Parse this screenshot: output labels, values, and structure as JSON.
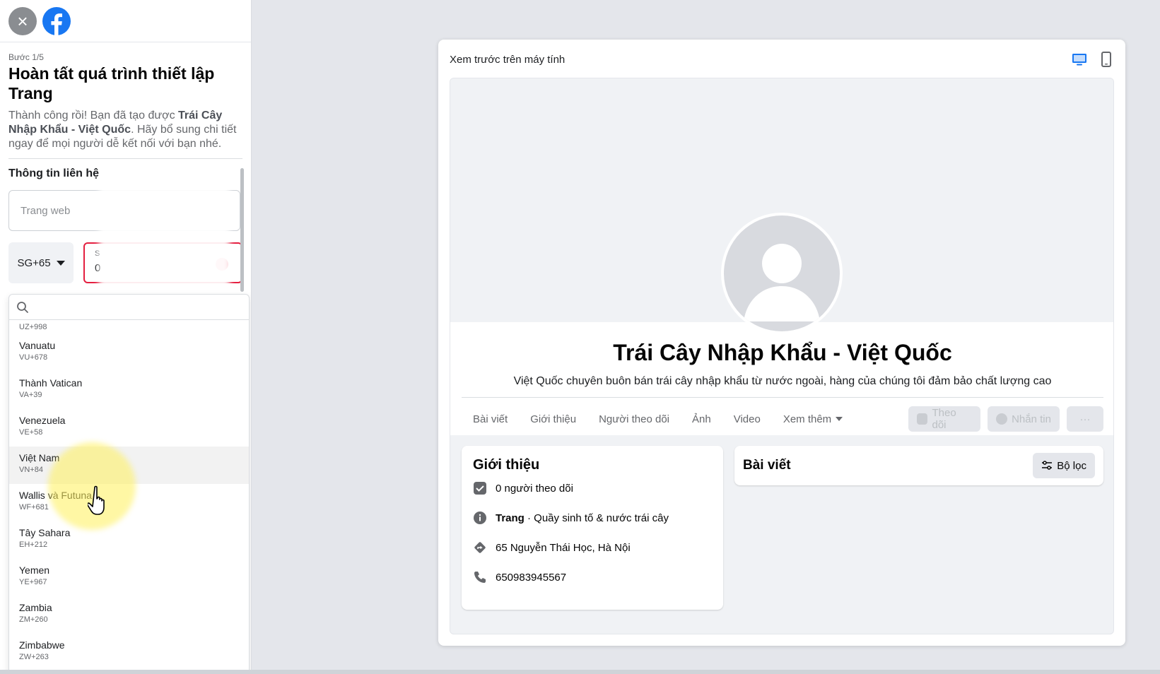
{
  "left_panel": {
    "step": "Bước 1/5",
    "title": "Hoàn tất quá trình thiết lập Trang",
    "desc_part1": "Thành công rồi! Bạn đã tạo được ",
    "desc_bold": "Trái Cây Nhập Khẩu - Việt Quốc",
    "desc_part2": ". Hãy bổ sung chi tiết ngay để mọi người dễ kết nối với bạn nhé.",
    "contact_label": "Thông tin liên hệ",
    "website_placeholder": "Trang web",
    "country_code": "SG+65",
    "phone_label_partial": "S",
    "phone_value_partial": "0",
    "dropdown_partial_top_code": "UZ+998",
    "countries": [
      {
        "name": "Vanuatu",
        "code": "VU+678"
      },
      {
        "name": "Thành Vatican",
        "code": "VA+39"
      },
      {
        "name": "Venezuela",
        "code": "VE+58"
      },
      {
        "name": "Việt Nam",
        "code": "VN+84"
      },
      {
        "name": "Wallis và Futuna",
        "code": "WF+681"
      },
      {
        "name": "Tây Sahara",
        "code": "EH+212"
      },
      {
        "name": "Yemen",
        "code": "YE+967"
      },
      {
        "name": "Zambia",
        "code": "ZM+260"
      },
      {
        "name": "Zimbabwe",
        "code": "ZW+263"
      }
    ]
  },
  "preview": {
    "title": "Xem trước trên máy tính",
    "page_name": "Trái Cây Nhập Khẩu - Việt Quốc",
    "page_desc": "Việt Quốc chuyên buôn bán trái cây nhập khẩu từ nước ngoài, hàng của chúng tôi đảm bảo chất lượng cao",
    "tabs": [
      "Bài viết",
      "Giới thiệu",
      "Người theo dõi",
      "Ảnh",
      "Video"
    ],
    "more_tab": "Xem thêm",
    "follow_btn": "Theo dõi",
    "message_btn": "Nhắn tin",
    "more_btn": "···",
    "intro_title": "Giới thiệu",
    "followers": "0 người theo dõi",
    "category_label": "Trang",
    "category_value": " · Quầy sinh tố & nước trái cây",
    "address": "65 Nguyễn Thái Học, Hà Nội",
    "phone": "650983945567",
    "posts_title": "Bài viết",
    "filter_btn": "Bộ lọc"
  },
  "colors": {
    "facebook_blue": "#1877f2",
    "error_red": "#e41e3f"
  }
}
